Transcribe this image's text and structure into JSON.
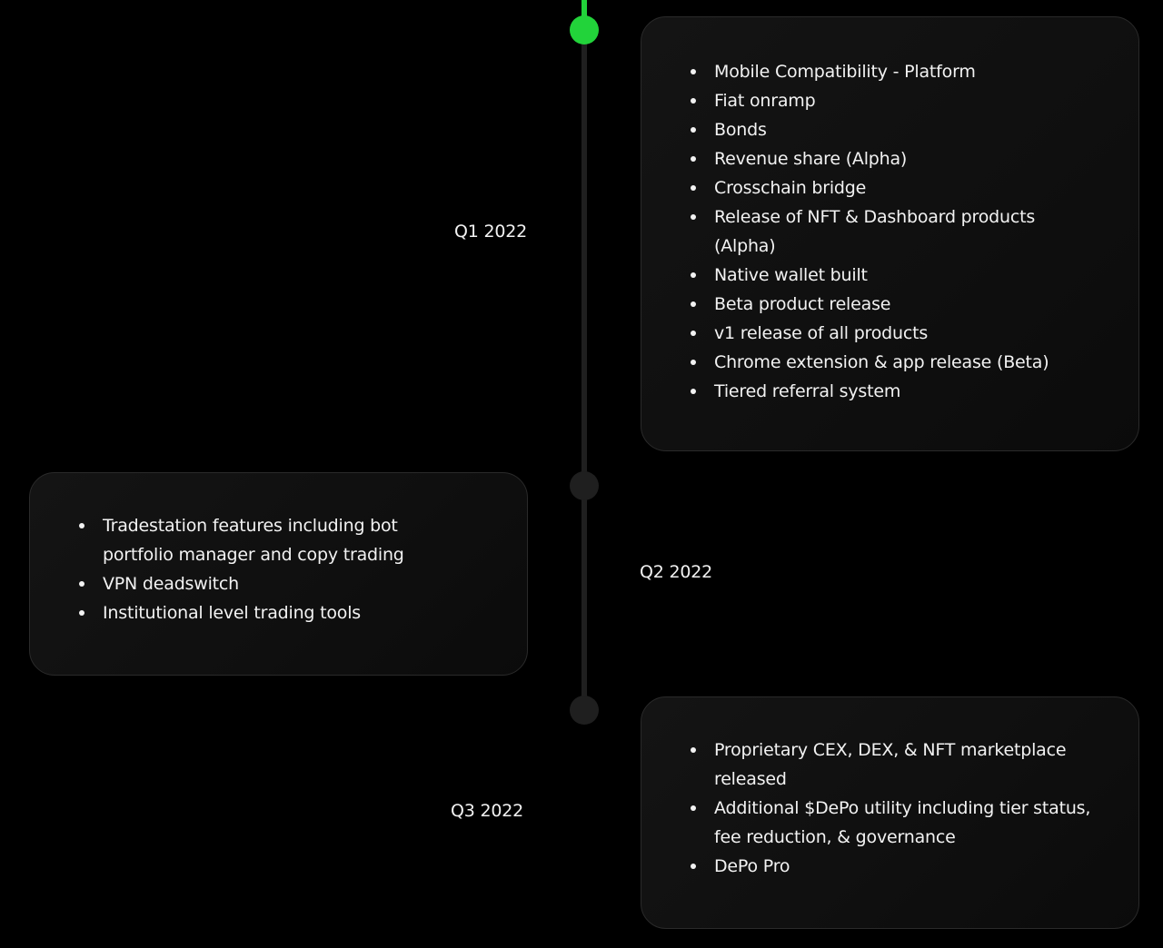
{
  "roadmap": {
    "colors": {
      "accent": "#22d33a",
      "line": "#1f1f1f",
      "card_border": "#2a2a2a",
      "background": "#000000"
    },
    "milestones": [
      {
        "quarter": "Q1 2022",
        "status": "active",
        "items": [
          "Mobile Compatibility - Platform",
          "Fiat onramp",
          "Bonds",
          "Revenue share (Alpha)",
          "Crosschain bridge",
          "Release of NFT & Dashboard products (Alpha)",
          "Native wallet built",
          "Beta product release",
          "v1 release of all products",
          "Chrome extension & app release (Beta)",
          "Tiered referral system"
        ]
      },
      {
        "quarter": "Q2 2022",
        "status": "upcoming",
        "items": [
          "Tradestation features including bot portfolio manager and copy trading",
          "VPN deadswitch",
          "Institutional level trading tools"
        ]
      },
      {
        "quarter": "Q3 2022",
        "status": "upcoming",
        "items": [
          "Proprietary CEX, DEX, & NFT marketplace released",
          "Additional $DePo utility including tier status, fee reduction, & governance",
          "DePo Pro"
        ]
      }
    ]
  }
}
